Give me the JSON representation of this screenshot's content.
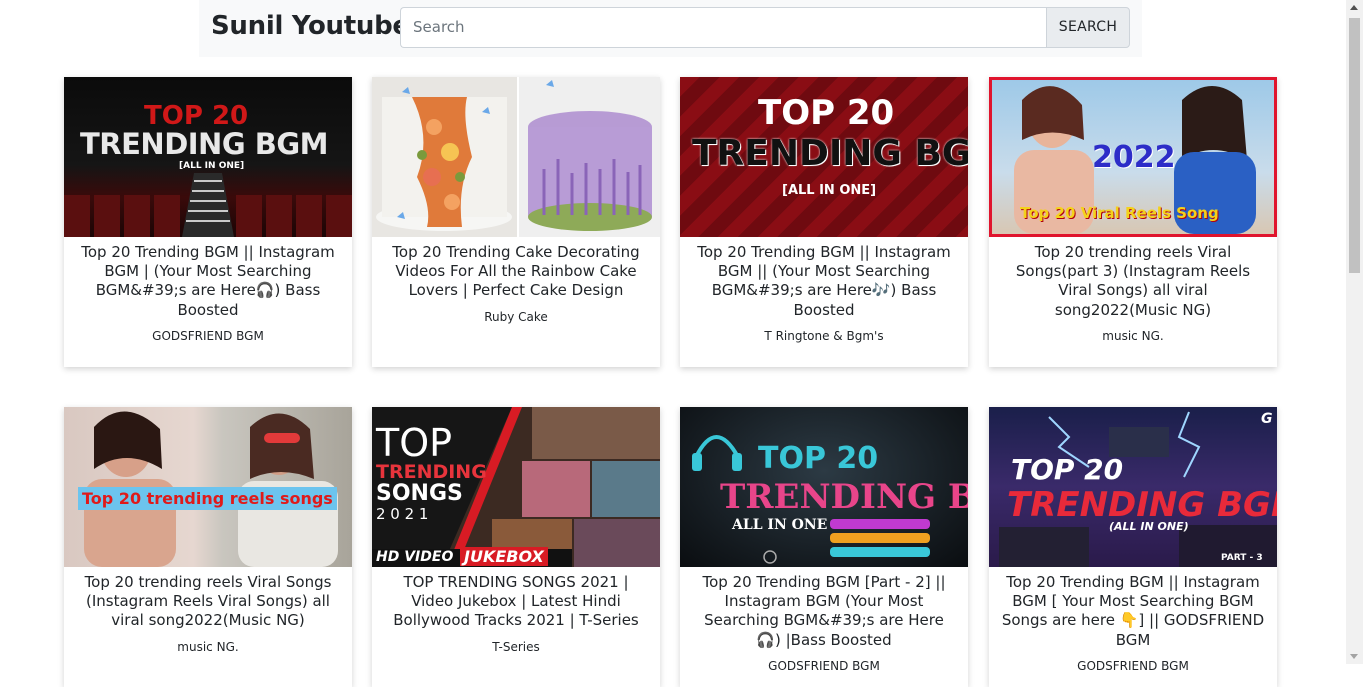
{
  "header": {
    "brand": "Sunil Youtube",
    "search_placeholder": "Search",
    "search_button": "SEARCH"
  },
  "videos": [
    {
      "title": "Top 20 Trending BGM || Instagram BGM | (Your Most Searching BGM&#39;s are Here🎧) Bass Boosted",
      "channel": "GODSFRIEND BGM",
      "thumb_lines": [
        "TOP 20",
        "TRENDING BGM",
        "[ALL IN ONE]"
      ]
    },
    {
      "title": "Top 20 Trending Cake Decorating Videos For All the Rainbow Cake Lovers | Perfect Cake Design",
      "channel": "Ruby Cake",
      "thumb_lines": []
    },
    {
      "title": "Top 20 Trending BGM || Instagram BGM || (Your Most Searching BGM&#39;s are Here🎶) Bass Boosted",
      "channel": "T Ringtone & Bgm's",
      "thumb_lines": [
        "TOP 20",
        "TRENDING BGM",
        "[ALL IN ONE]"
      ]
    },
    {
      "title": "Top 20 trending reels Viral Songs(part 3) (Instagram Reels Viral Songs) all viral song2022(Music NG)",
      "channel": "music NG.",
      "thumb_lines": [
        "2022",
        "Top 20 Viral Reels Song"
      ]
    },
    {
      "title": "Top 20 trending reels Viral Songs (Instagram Reels Viral Songs) all viral song2022(Music NG)",
      "channel": "music NG.",
      "thumb_lines": [
        "Top 20 trending reels songs"
      ]
    },
    {
      "title": "TOP TRENDING SONGS 2021 | Video Jukebox | Latest Hindi Bollywood Tracks 2021 | T-Series",
      "channel": "T-Series",
      "thumb_lines": [
        "TOP",
        "TRENDING",
        "SONGS",
        "2 0 2 1",
        "HD VIDEO",
        "JUKEBOX"
      ]
    },
    {
      "title": "Top 20 Trending BGM [Part - 2] || Instagram BGM (Your Most Searching BGM&#39;s are Here 🎧) |Bass Boosted",
      "channel": "GODSFRIEND BGM",
      "thumb_lines": [
        "TOP 20",
        "TRENDING BGM",
        "ALL IN ONE"
      ]
    },
    {
      "title": "Top 20 Trending BGM || Instagram BGM [ Your Most Searching BGM Songs are here 👇] || GODSFRIEND BGM",
      "channel": "GODSFRIEND BGM",
      "thumb_lines": [
        "TOP 20",
        "TRENDING BGM",
        "(ALL IN ONE)",
        "PART - 3",
        "G"
      ]
    }
  ]
}
